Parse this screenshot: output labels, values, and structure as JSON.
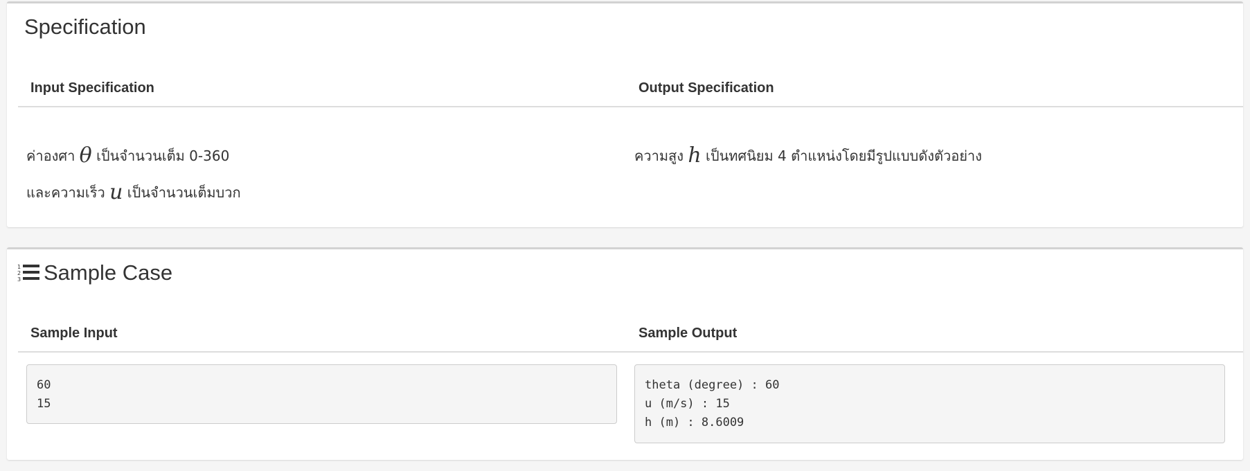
{
  "specification": {
    "title": "Specification",
    "input_header": "Input Specification",
    "output_header": "Output Specification",
    "input_line1": {
      "before": "ค่าองศา",
      "var": "θ",
      "after": "เป็นจำนวนเต็ม 0-360"
    },
    "input_line2": {
      "before": "และความเร็ว",
      "var": "u",
      "after": "เป็นจำนวนเต็มบวก"
    },
    "output_line1": {
      "before": "ความสูง",
      "var": "h",
      "after": "เป็นทศนิยม 4 ตำแหน่งโดยมีรูปแบบดังตัวอย่าง"
    }
  },
  "sample_case": {
    "icon": "list-ol-icon",
    "title": "Sample Case",
    "input_header": "Sample Input",
    "output_header": "Sample Output",
    "input_lines": "60\n15",
    "output_lines": "theta (degree) : 60\nu (m/s) : 15\nh (m) : 8.6009"
  }
}
